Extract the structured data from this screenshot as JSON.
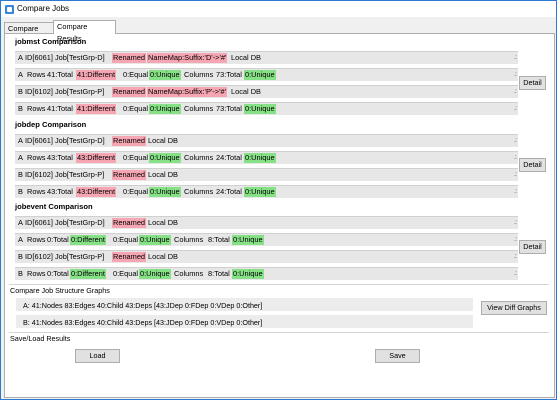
{
  "window": {
    "title": "Compare Jobs"
  },
  "tabs": [
    "Compare Jobs",
    "Compare Results"
  ],
  "sections": [
    {
      "title": "jobmst Comparison",
      "rows": [
        {
          "prefix": "A",
          "id": "ID[6061] Job[TestGrp-D]",
          "renamed": "Renamed",
          "namemap": "NameMap:Suffix:'D'->'#'",
          "db": "Local DB"
        },
        {
          "prefix": "A",
          "rows": "Rows",
          "total": "41:Total",
          "diff": "41:Different",
          "equal": "0:Equal",
          "unique": "0:Unique",
          "columns": "Columns",
          "ctotal": "73:Total",
          "cunique": "0:Unique"
        },
        {
          "prefix": "B",
          "id": "ID[6102] Job[TestGrp-P]",
          "renamed": "Renamed",
          "namemap": "NameMap:Suffix:'P'->'#'",
          "db": "Local DB"
        },
        {
          "prefix": "B",
          "rows": "Rows",
          "total": "41:Total",
          "diff": "41:Different",
          "equal": "0:Equal",
          "unique": "0:Unique",
          "columns": "Columns",
          "ctotal": "73:Total",
          "cunique": "0:Unique"
        }
      ],
      "detail": "Detail"
    },
    {
      "title": "jobdep Comparison",
      "rows": [
        {
          "prefix": "A",
          "id": "ID[6061] Job[TestGrp-D]",
          "renamed": "Renamed",
          "db": "Local DB"
        },
        {
          "prefix": "A",
          "rows": "Rows",
          "total": "43:Total",
          "diff": "43:Different",
          "equal": "0:Equal",
          "unique": "0:Unique",
          "columns": "Columns",
          "ctotal": "24:Total",
          "cunique": "0:Unique"
        },
        {
          "prefix": "B",
          "id": "ID[6102] Job[TestGrp-P]",
          "renamed": "Renamed",
          "db": "Local DB"
        },
        {
          "prefix": "B",
          "rows": "Rows",
          "total": "43:Total",
          "diff": "43:Different",
          "equal": "0:Equal",
          "unique": "0:Unique",
          "columns": "Columns",
          "ctotal": "24:Total",
          "cunique": "0:Unique"
        }
      ],
      "detail": "Detail"
    },
    {
      "title": "jobevent Comparison",
      "rows": [
        {
          "prefix": "A",
          "id": "ID[6061] Job[TestGrp-D]",
          "renamed": "Renamed",
          "db": "Local DB"
        },
        {
          "prefix": "A",
          "rows": "Rows",
          "total": "0:Total",
          "diff": "0:Different",
          "equal": "0:Equal",
          "unique": "0:Unique",
          "columns": "Columns",
          "ctotal": "8:Total",
          "cunique": "0:Unique"
        },
        {
          "prefix": "B",
          "id": "ID[6102] Job[TestGrp-P]",
          "renamed": "Renamed",
          "db": "Local DB"
        },
        {
          "prefix": "B",
          "rows": "Rows",
          "total": "0:Total",
          "diff": "0:Different",
          "equal": "0:Equal",
          "unique": "0:Unique",
          "columns": "Columns",
          "ctotal": "8:Total",
          "cunique": "0:Unique"
        }
      ],
      "detail": "Detail"
    }
  ],
  "graphs": {
    "title": "Compare Job Structure Graphs",
    "a": "A: 41:Nodes 83:Edges 40:Child 43:Deps [43:JDep 0:FDep 0:VDep 0:Other]",
    "b": "B: 41:Nodes 83:Edges 40:Child 43:Deps [43:JDep 0:FDep 0:VDep 0:Other]",
    "button": "View Diff Graphs"
  },
  "saveload": {
    "title": "Save/Load Results",
    "load": "Load",
    "save": "Save"
  }
}
